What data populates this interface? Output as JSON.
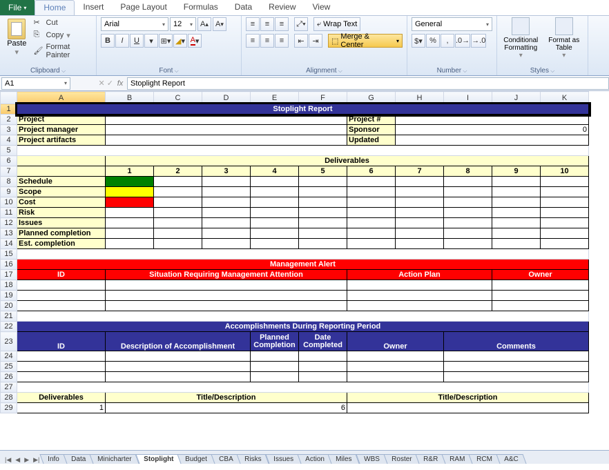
{
  "app": {
    "file_label": "File",
    "tabs": [
      "Home",
      "Insert",
      "Page Layout",
      "Formulas",
      "Data",
      "Review",
      "View"
    ],
    "active_tab": "Home"
  },
  "ribbon": {
    "clipboard": {
      "paste": "Paste",
      "cut": "Cut",
      "copy": "Copy",
      "fp": "Format Painter",
      "label": "Clipboard"
    },
    "font": {
      "name": "Arial",
      "size": "12",
      "label": "Font",
      "bold": "B",
      "italic": "I",
      "underline": "U"
    },
    "align": {
      "wrap": "Wrap Text",
      "merge": "Merge & Center",
      "label": "Alignment"
    },
    "number": {
      "format": "General",
      "label": "Number"
    },
    "styles": {
      "cond": "Conditional Formatting",
      "fat": "Format as Table",
      "label": "Styles"
    }
  },
  "fbar": {
    "name": "A1",
    "fx": "fx",
    "formula": "Stoplight Report"
  },
  "cols": [
    "A",
    "B",
    "C",
    "D",
    "E",
    "F",
    "G",
    "H",
    "I",
    "J",
    "K"
  ],
  "rows": [
    "1",
    "2",
    "3",
    "4",
    "5",
    "6",
    "7",
    "8",
    "9",
    "10",
    "11",
    "12",
    "13",
    "14",
    "15",
    "16",
    "17",
    "18",
    "19",
    "20",
    "21",
    "22",
    "23",
    "24",
    "25",
    "26",
    "27",
    "28",
    "29"
  ],
  "sheet": {
    "title": "Stoplight Report",
    "proj": {
      "l1": "Project",
      "l2": "Project manager",
      "l3": "Project artifacts",
      "r1": "Project #",
      "r2": "Sponsor",
      "r3": "Updated",
      "v2": "0"
    },
    "deliv_hdr": "Deliverables",
    "deliv_nums": [
      "1",
      "2",
      "3",
      "4",
      "5",
      "6",
      "7",
      "8",
      "9",
      "10"
    ],
    "rows_lbl": {
      "schedule": "Schedule",
      "scope": "Scope",
      "cost": "Cost",
      "risk": "Risk",
      "issues": "Issues",
      "pc": "Planned completion",
      "ec": "Est. completion"
    },
    "mgmt": {
      "title": "Management Alert",
      "id": "ID",
      "sit": "Situation Requiring Management Attention",
      "ap": "Action Plan",
      "owner": "Owner"
    },
    "acc": {
      "title": "Accomplishments During Reporting Period",
      "id": "ID",
      "desc": "Description of Accomplishment",
      "pc": "Planned Completion",
      "dc": "Date Completed",
      "owner": "Owner",
      "com": "Comments"
    },
    "btm": {
      "deliv": "Deliverables",
      "td": "Title/Description",
      "n1": "1",
      "n6": "6"
    }
  },
  "tabs": [
    "Info",
    "Data",
    "Minicharter",
    "Stoplight",
    "Budget",
    "CBA",
    "Risks",
    "Issues",
    "Action",
    "Miles",
    "WBS",
    "Roster",
    "R&R",
    "RAM",
    "RCM",
    "A&C"
  ],
  "active_sheet": "Stoplight"
}
